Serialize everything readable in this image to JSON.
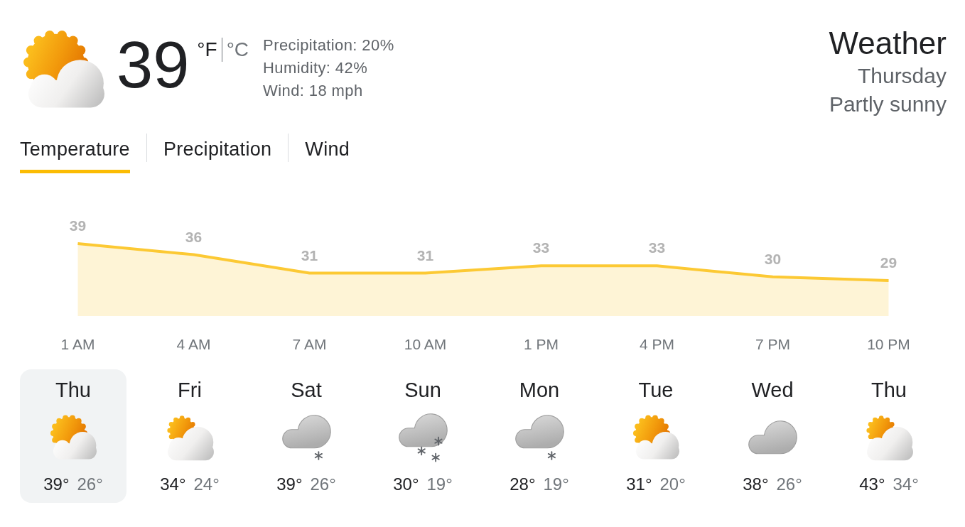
{
  "current": {
    "kind": "partly-sunny",
    "temperature": "39",
    "units": [
      {
        "label": "°F",
        "selected": true
      },
      {
        "label": "°C",
        "selected": false
      }
    ],
    "details": [
      "Precipitation: 20%",
      "Humidity: 42%",
      "Wind: 18 mph"
    ]
  },
  "summary": {
    "title": "Weather",
    "day": "Thursday",
    "condition": "Partly sunny"
  },
  "tabs": [
    {
      "label": "Temperature",
      "selected": true
    },
    {
      "label": "Precipitation",
      "selected": false
    },
    {
      "label": "Wind",
      "selected": false
    }
  ],
  "chart_data": {
    "type": "area",
    "categories": [
      "1 AM",
      "4 AM",
      "7 AM",
      "10 AM",
      "1 PM",
      "4 PM",
      "7 PM",
      "10 PM"
    ],
    "values": [
      39,
      36,
      31,
      31,
      33,
      33,
      30,
      29
    ],
    "color": "#fcc934",
    "data_labels": true
  },
  "days": [
    {
      "day": "Thu",
      "kind": "partly-sunny",
      "high": "39°",
      "low": "26°",
      "selected": true
    },
    {
      "day": "Fri",
      "kind": "mostly-cloudy",
      "high": "34°",
      "low": "24°",
      "selected": false
    },
    {
      "day": "Sat",
      "kind": "light-snow",
      "high": "39°",
      "low": "26°",
      "selected": false
    },
    {
      "day": "Sun",
      "kind": "snow",
      "high": "30°",
      "low": "19°",
      "selected": false
    },
    {
      "day": "Mon",
      "kind": "light-snow",
      "high": "28°",
      "low": "19°",
      "selected": false
    },
    {
      "day": "Tue",
      "kind": "partly-sunny",
      "high": "31°",
      "low": "20°",
      "selected": false
    },
    {
      "day": "Wed",
      "kind": "cloudy",
      "high": "38°",
      "low": "26°",
      "selected": false
    },
    {
      "day": "Thu",
      "kind": "mostly-cloudy",
      "high": "43°",
      "low": "34°",
      "selected": false
    }
  ]
}
